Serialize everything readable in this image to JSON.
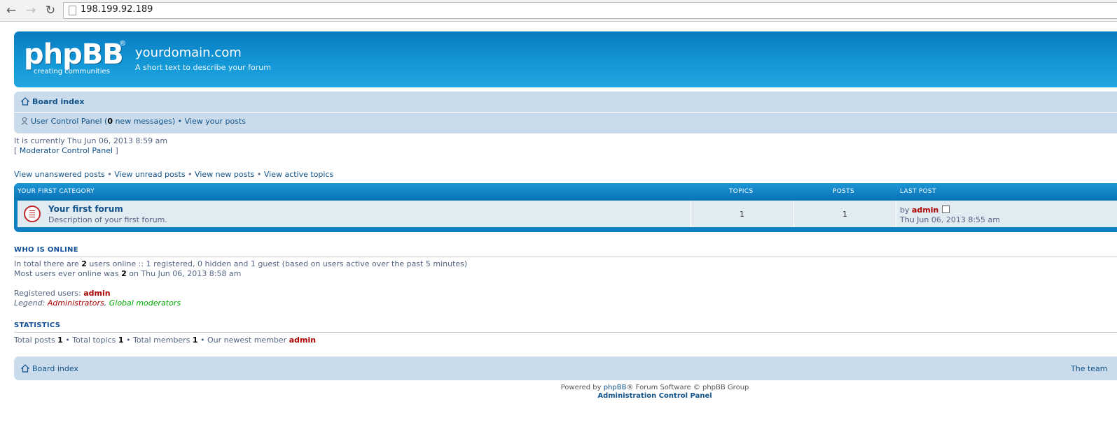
{
  "browser": {
    "url": "198.199.92.189",
    "back_icon": "back-arrow-icon",
    "forward_icon": "forward-arrow-icon",
    "reload_icon": "reload-icon"
  },
  "header": {
    "logo_text": "phpBB",
    "logo_reg": "®",
    "logo_sub": "creating   communities",
    "site_title": "yourdomain.com",
    "site_desc": "A short text to describe your forum"
  },
  "nav": {
    "board_index": "Board index",
    "ucp": "User Control Panel",
    "ucp_open": " (",
    "new_messages_count": "0",
    "new_messages_label": " new messages)",
    "sep": " • ",
    "view_posts": "View your posts"
  },
  "status": {
    "current_time": "It is currently Thu Jun 06, 2013 8:59 am",
    "mcp_open": "[ ",
    "mcp": "Moderator Control Panel",
    "mcp_close": " ]"
  },
  "quicklinks": [
    "View unanswered posts",
    "View unread posts",
    "View new posts",
    "View active topics"
  ],
  "quicklink_sep": " • ",
  "forum_table": {
    "category": "YOUR FIRST CATEGORY",
    "col_topics": "TOPICS",
    "col_posts": "POSTS",
    "col_lastpost": "LAST POST",
    "rows": [
      {
        "title": "Your first forum",
        "description": "Description of your first forum.",
        "topics": "1",
        "posts": "1",
        "by": "by ",
        "last_user": "admin",
        "last_date": "Thu Jun 06, 2013 8:55 am"
      }
    ]
  },
  "online": {
    "heading": "WHO IS ONLINE",
    "line1_a": "In total there are ",
    "line1_count": "2",
    "line1_b": " users online :: 1 registered, 0 hidden and 1 guest (based on users active over the past 5 minutes)",
    "line2_a": "Most users ever online was ",
    "line2_count": "2",
    "line2_b": " on Thu Jun 06, 2013 8:58 am",
    "registered_label": "Registered users: ",
    "registered_user": "admin",
    "legend_label": "Legend: ",
    "legend_admins": "Administrators",
    "legend_comma": ", ",
    "legend_mods": "Global moderators"
  },
  "stats": {
    "heading": "STATISTICS",
    "a": "Total posts ",
    "posts": "1",
    "b": " • Total topics ",
    "topics": "1",
    "c": " • Total members ",
    "members": "1",
    "d": " • Our newest member ",
    "newest": "admin"
  },
  "footer": {
    "board_index": "Board index",
    "team": "The team",
    "powered_a": "Powered by ",
    "powered_link": "phpBB",
    "powered_b": "® Forum Software © phpBB Group",
    "acp": "Administration Control Panel"
  },
  "colors": {
    "header_blue": "#1296d6",
    "nav_bg": "#cadceb",
    "link": "#105289",
    "admin_red": "#aa0000",
    "moderator_green": "#00aa00"
  }
}
